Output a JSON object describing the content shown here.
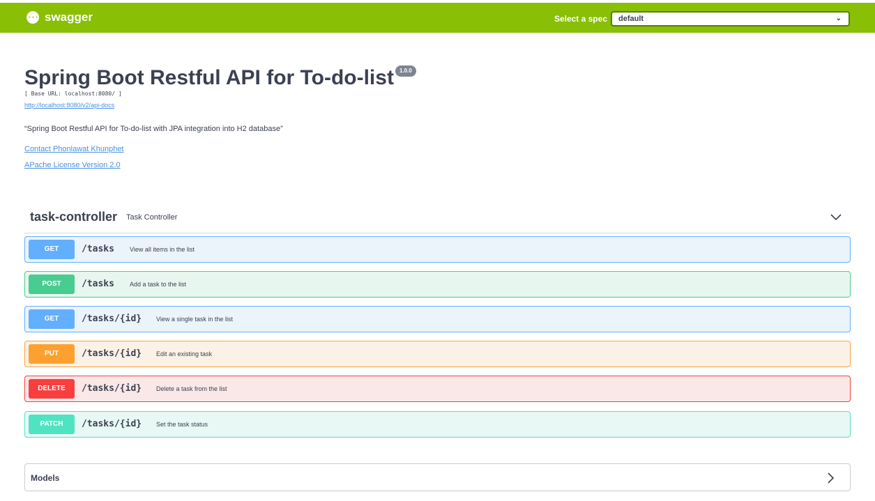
{
  "topbar": {
    "logo_icon": "{···}",
    "logo_text": "swagger",
    "spec_label": "Select a spec",
    "spec_value": "default",
    "color": "#89bf04"
  },
  "info": {
    "title": "Spring Boot Restful API for To-do-list",
    "version": "1.0.0",
    "base_url": "[ Base URL: localhost:8080/ ]",
    "docs_link": "http://localhost:8080/v2/api-docs",
    "description": "“Spring Boot Restful API for To-do-list with JPA integration into H2 database”",
    "contact": "Contact Phonlawat Khunphet",
    "license": "APache License Version 2.0"
  },
  "section": {
    "tag": "task-controller",
    "description": "Task Controller",
    "expand_icon": "chevron-down-icon"
  },
  "operations": [
    {
      "method": "GET",
      "path": "/tasks",
      "summary": "View all items in the list"
    },
    {
      "method": "POST",
      "path": "/tasks",
      "summary": "Add a task to the list"
    },
    {
      "method": "GET",
      "path": "/tasks/{id}",
      "summary": "View a single task in the list"
    },
    {
      "method": "PUT",
      "path": "/tasks/{id}",
      "summary": "Edit an existing task"
    },
    {
      "method": "DELETE",
      "path": "/tasks/{id}",
      "summary": "Delete a task from the list"
    },
    {
      "method": "PATCH",
      "path": "/tasks/{id}",
      "summary": "Set the task status"
    }
  ],
  "models": {
    "title": "Models",
    "expand_icon": "chevron-right-icon"
  },
  "colors": {
    "get": "#61affe",
    "post": "#49cc90",
    "put": "#fca130",
    "delete": "#f93e3e",
    "patch": "#50e3c2"
  }
}
